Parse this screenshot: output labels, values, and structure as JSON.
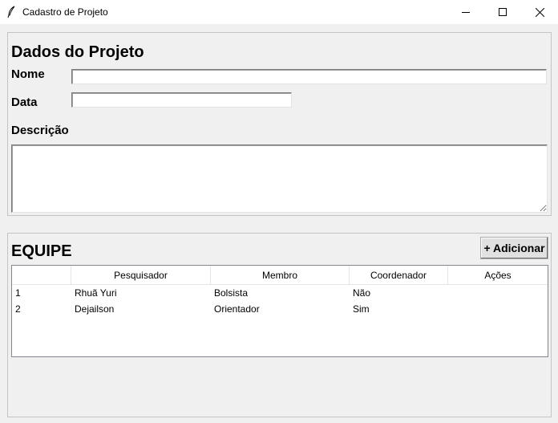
{
  "window": {
    "title": "Cadastro de Projeto",
    "icon": "feather-icon",
    "controls": [
      "minimize-icon",
      "maximize-icon",
      "close-icon"
    ]
  },
  "project": {
    "heading": "Dados do Projeto",
    "nome_label": "Nome",
    "nome_value": "",
    "data_label": "Data",
    "data_value": "",
    "descricao_label": "Descrição",
    "descricao_value": ""
  },
  "team": {
    "heading": "EQUIPE",
    "add_button": "+ Adicionar",
    "columns": [
      "",
      "Pesquisador",
      "Membro",
      "Coordenador",
      "Ações"
    ],
    "rows": [
      {
        "id": "1",
        "pesquisador": "Rhuã Yuri",
        "membro": "Bolsista",
        "coordenador": "Não",
        "acoes": ""
      },
      {
        "id": "2",
        "pesquisador": "Dejailson",
        "membro": "Orientador",
        "coordenador": "Sim",
        "acoes": ""
      }
    ]
  }
}
